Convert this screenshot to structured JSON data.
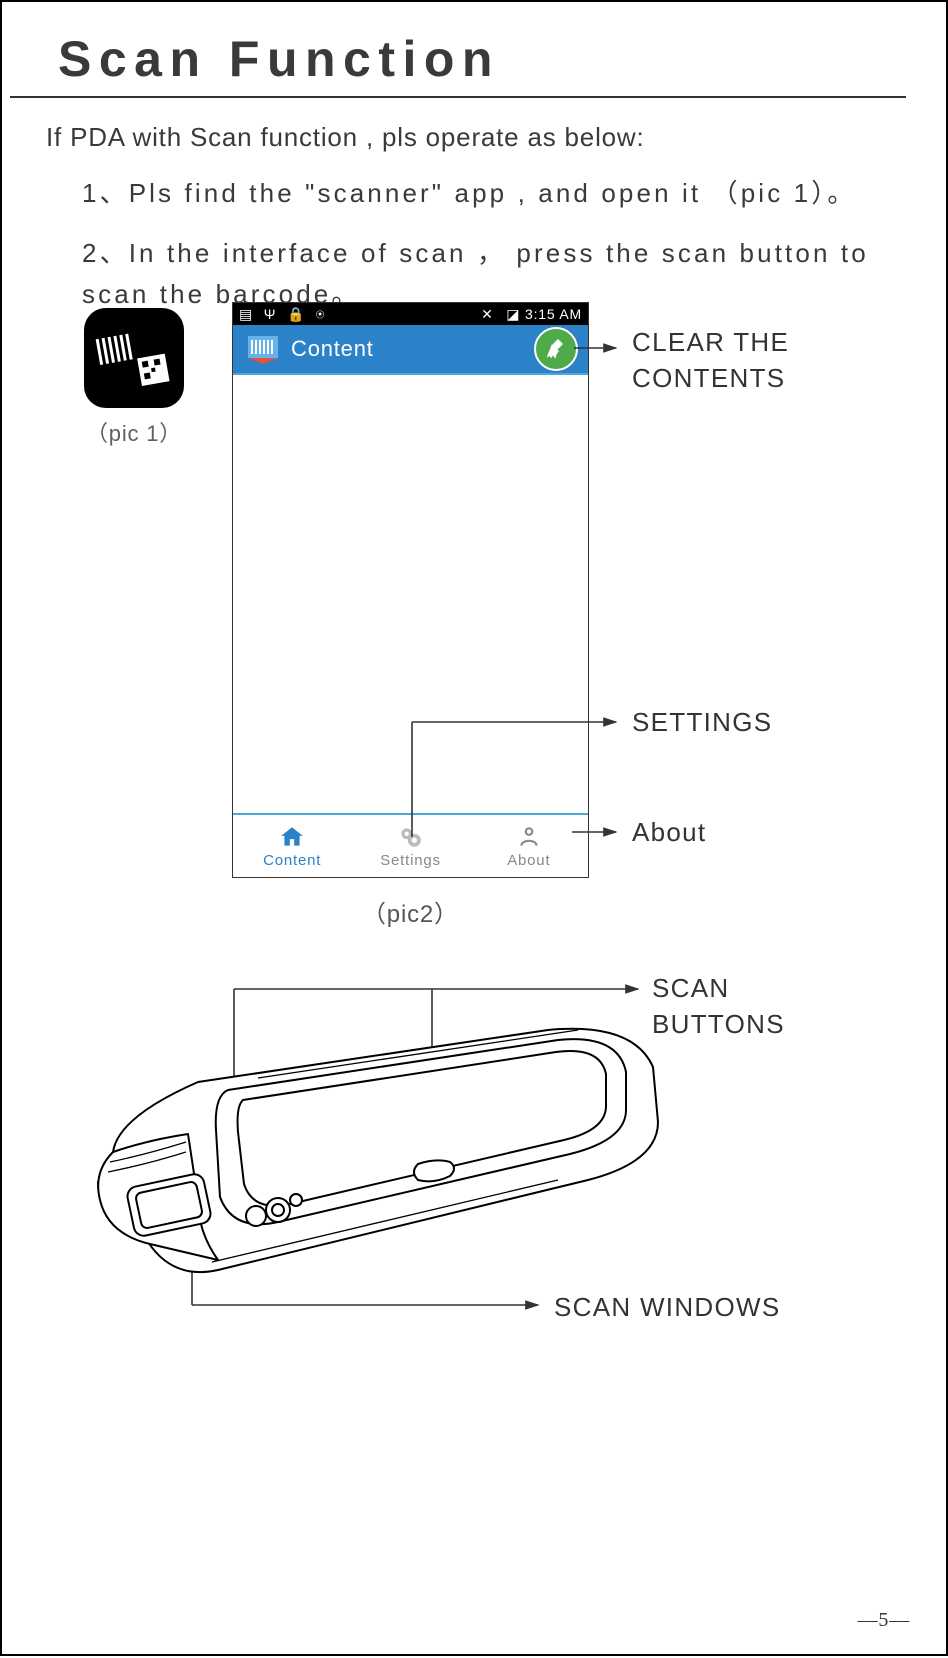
{
  "title": "Scan  Function",
  "intro": "If PDA with Scan function , pls operate as below:",
  "step1": "1、Pls  find  the  \"scanner\"  app  , and  open  it （pic 1）。",
  "step2": "2、In  the  interface  of  scan  ，  press  the  scan  button  to scan  the  barcode。",
  "caption1": "（pic 1）",
  "caption2": "（pic2）",
  "statusbar": {
    "time": "3:15 AM"
  },
  "header": {
    "title": "Content"
  },
  "nav": {
    "content": "Content",
    "settings": "Settings",
    "about": "About"
  },
  "labels": {
    "clear": "CLEAR THE CONTENTS",
    "settings": "SETTINGS",
    "about": "About",
    "scanButtons": "SCAN BUTTONS",
    "scanWindows": "SCAN  WINDOWS"
  },
  "pagenum": "—5—"
}
